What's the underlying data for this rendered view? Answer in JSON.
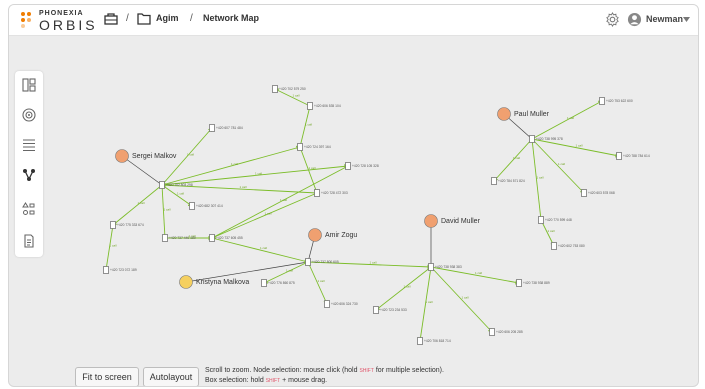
{
  "app": {
    "logo_top": "PHONEXIA",
    "logo_main": "ORBIS",
    "brand_color": "#f07d00"
  },
  "breadcrumb": {
    "sep1": "/",
    "folder": "Agim",
    "sep2": "/",
    "page": "Network Map"
  },
  "user": {
    "name": "Newman"
  },
  "sidebar": {
    "items": [
      {
        "name": "panels-icon"
      },
      {
        "name": "target-icon"
      },
      {
        "name": "list-icon"
      },
      {
        "name": "network-icon"
      },
      {
        "name": "shapes-icon"
      },
      {
        "name": "document-icon"
      }
    ]
  },
  "graph": {
    "persons": [
      {
        "label": "Sergei Malkov",
        "color": "#f0a070"
      },
      {
        "label": "Kristyna Malkova",
        "color": "#f5d060"
      },
      {
        "label": "Amir Zogu",
        "color": "#f0a070"
      },
      {
        "label": "David Muller",
        "color": "#f0a070"
      },
      {
        "label": "Paul Muller",
        "color": "#f0a070"
      }
    ],
    "phones": [
      "+420 702 579 250",
      "+420 606 535 104",
      "+420 607 781 484",
      "+420 724 397 164",
      "+420 702 803 298",
      "+420 682 307 414",
      "+420 728 105 328",
      "+420 728 472 303",
      "+420 775 333 674",
      "+420 737 440 180",
      "+420 737 605 455",
      "+420 723 072 189",
      "+420 737 800 605",
      "+420 776 860 875",
      "+420 606 324 730",
      "+420 738 938 383",
      "+420 723 234 533",
      "+420 738 938 889",
      "+420 706 818 714",
      "+420 606 205 285",
      "+420 753 622 600",
      "+420 738 995 378",
      "+420 788 784 614",
      "+420 784 571 824",
      "+420 603 578 068",
      "+420 770 599 448",
      "+420 602 753 080"
    ],
    "edge_label": "1 call",
    "edge_color": "#7cbd2a"
  },
  "controls": {
    "fit_label": "Fit to screen",
    "auto_label": "Autolayout",
    "hint_line1a": "Scroll to zoom. Node selection: mouse click (hold ",
    "hint_key1": "SHIFT",
    "hint_line1b": " for multiple selection).",
    "hint_line2a": "Box selection: hold ",
    "hint_key2": "SHIFT",
    "hint_line2b": " + mouse drag."
  }
}
